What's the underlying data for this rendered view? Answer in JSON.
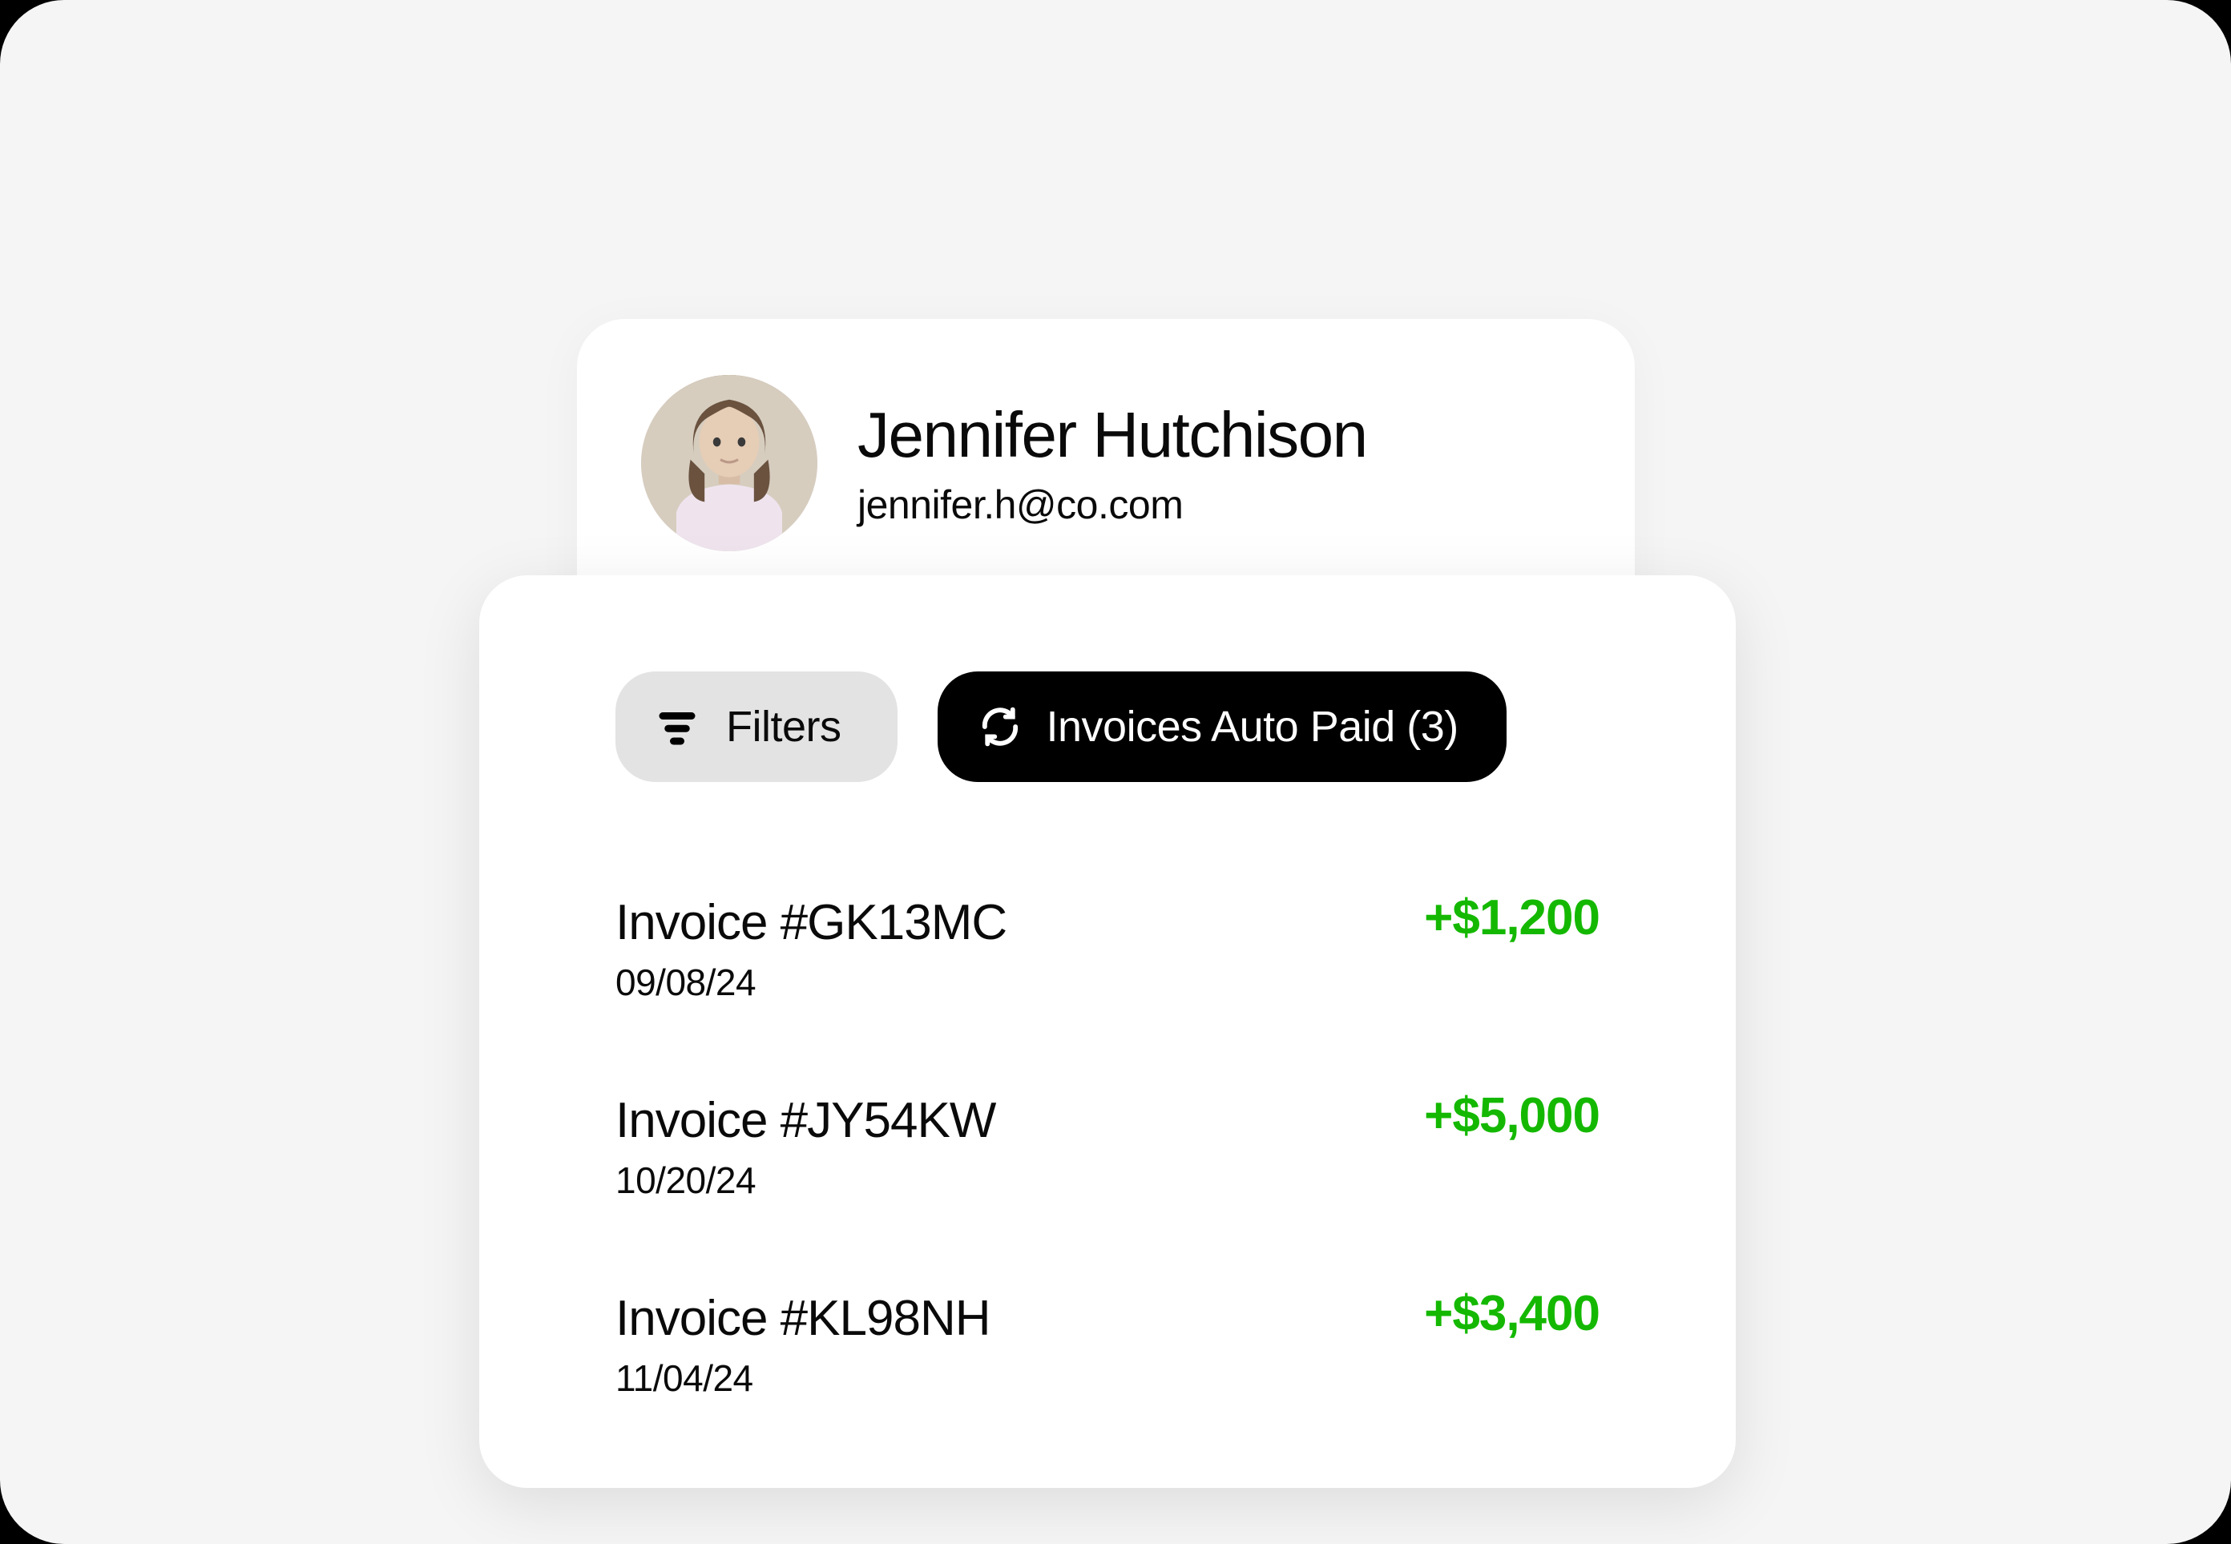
{
  "profile": {
    "name": "Jennifer Hutchison",
    "email": "jennifer.h@co.com"
  },
  "controls": {
    "filters_label": "Filters",
    "autopaid_label": "Invoices Auto Paid (3)"
  },
  "invoices": [
    {
      "title": "Invoice #GK13MC",
      "date": "09/08/24",
      "amount": "+$1,200"
    },
    {
      "title": "Invoice #JY54KW",
      "date": "10/20/24",
      "amount": "+$5,000"
    },
    {
      "title": "Invoice #KL98NH",
      "date": "11/04/24",
      "amount": "+$3,400"
    }
  ]
}
